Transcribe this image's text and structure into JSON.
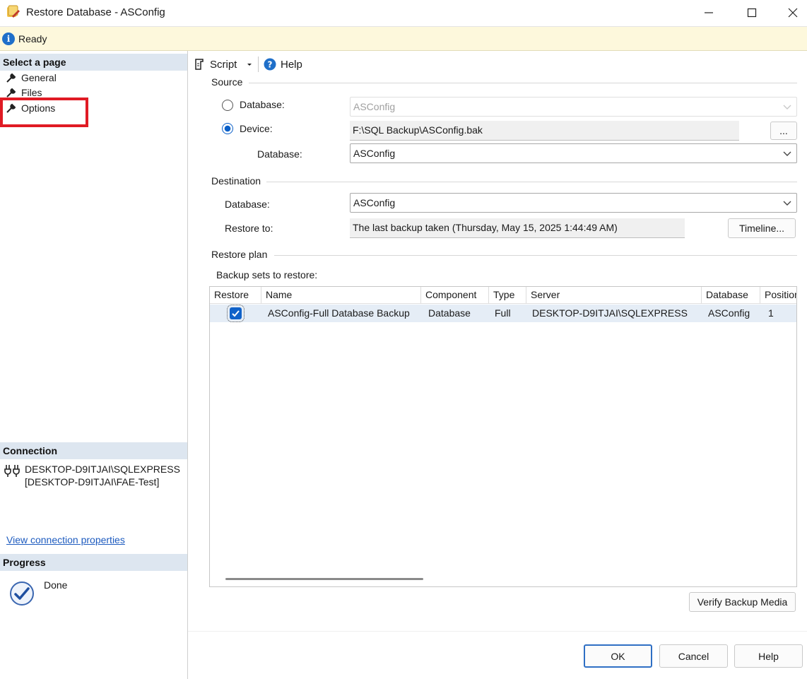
{
  "window": {
    "title": "Restore Database - ASConfig",
    "icon": "sql-restore-icon"
  },
  "status": {
    "text": "Ready",
    "icon": "info-icon"
  },
  "left_panel": {
    "select_page_header": "Select a page",
    "pages": [
      {
        "label": "General",
        "icon": "wrench-icon"
      },
      {
        "label": "Files",
        "icon": "wrench-icon"
      },
      {
        "label": "Options",
        "icon": "wrench-icon"
      }
    ],
    "highlight_color": "#e01b24",
    "connection_header": "Connection",
    "connection_text": "DESKTOP-D9ITJAI\\SQLEXPRESS [DESKTOP-D9ITJAI\\FAE-Test]",
    "view_connection_link": "View connection properties",
    "progress_header": "Progress",
    "progress_status": "Done"
  },
  "toolbar": {
    "script_label": "Script",
    "help_label": "Help"
  },
  "source": {
    "group_label": "Source",
    "database_radio_label": "Database:",
    "database_radio_value": "ASConfig",
    "device_radio_label": "Device:",
    "device_value": "F:\\SQL Backup\\ASConfig.bak",
    "browse_label": "...",
    "device_database_label": "Database:",
    "device_database_value": "ASConfig",
    "selected": "device"
  },
  "destination": {
    "group_label": "Destination",
    "database_label": "Database:",
    "database_value": "ASConfig",
    "restore_to_label": "Restore to:",
    "restore_to_value": "The last backup taken (Thursday, May 15, 2025 1:44:49 AM)",
    "timeline_label": "Timeline..."
  },
  "restore_plan": {
    "group_label": "Restore plan",
    "sets_label": "Backup sets to restore:",
    "columns": [
      "Restore",
      "Name",
      "Component",
      "Type",
      "Server",
      "Database",
      "Position"
    ],
    "rows": [
      {
        "restore": true,
        "name": "ASConfig-Full Database Backup",
        "component": "Database",
        "type": "Full",
        "server": "DESKTOP-D9ITJAI\\SQLEXPRESS",
        "database": "ASConfig",
        "position": "1"
      }
    ],
    "verify_label": "Verify Backup Media"
  },
  "footer": {
    "ok_label": "OK",
    "cancel_label": "Cancel",
    "help_label": "Help"
  }
}
